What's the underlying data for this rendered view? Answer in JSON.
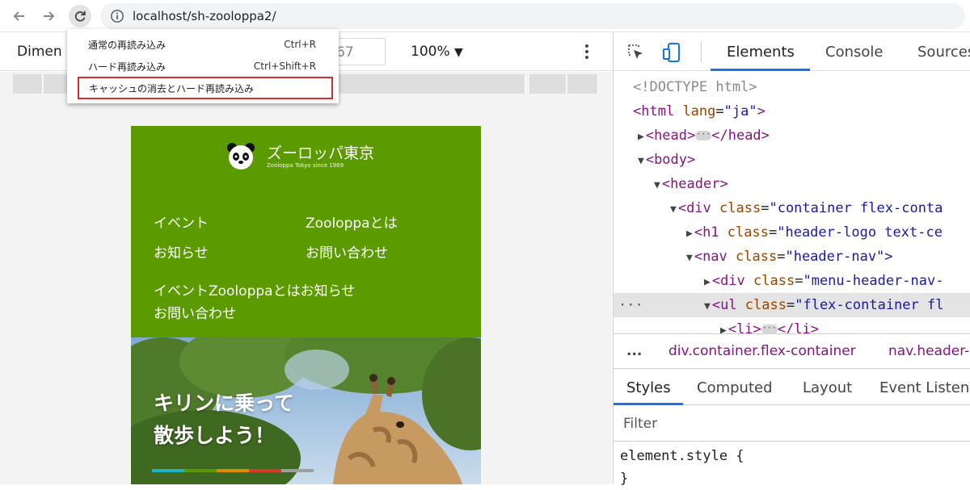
{
  "browser": {
    "url": "localhost/sh-zooloppa2/"
  },
  "context_menu": {
    "items": [
      {
        "label": "通常の再読み込み",
        "shortcut": "Ctrl+R"
      },
      {
        "label": "ハード再読み込み",
        "shortcut": "Ctrl+Shift+R"
      },
      {
        "label": "キャッシュの消去とハード再読み込み",
        "shortcut": ""
      }
    ]
  },
  "device_toolbar": {
    "dimensions_label": "Dimen",
    "height_value": "67",
    "zoom": "100%",
    "zoom_arrow": "▼"
  },
  "site": {
    "brand_name": "ズーロッパ東京",
    "tagline": "Zooloppa Tokyo since 1969",
    "nav_grid": [
      "イベント",
      "Zooloppaとは",
      "お知らせ",
      "お問い合わせ"
    ],
    "nav_inline_1": "イベントZooloppaとはお知らせ",
    "nav_inline_2": "お問い合わせ",
    "hero_line_1": "キリンに乗って",
    "hero_line_2": "散歩しよう！",
    "header_color": "#5b9b00",
    "stripe_colors": [
      "#1fb3c9",
      "#5a9a00",
      "#e08a00",
      "#d93b2b",
      "#9e9e9e"
    ]
  },
  "devtools": {
    "tabs": [
      "Elements",
      "Console",
      "Sources"
    ],
    "active_tab": "Elements",
    "code_lines": {
      "doctype": "<!DOCTYPE html>",
      "html_open": "<html",
      "html_attr": "lang",
      "html_val": "\"ja\"",
      "head_open": "<head>",
      "head_close": "</head>",
      "body_open": "<body>",
      "header_open": "<header>",
      "div_open": "<div",
      "div_attr": "class",
      "div_val": "\"container flex-conta",
      "h1_open": "<h1",
      "h1_attr": "class",
      "h1_val": "\"header-logo text-ce",
      "nav_open": "<nav",
      "nav_attr": "class",
      "nav_val": "\"header-nav\">",
      "div2_open": "<div",
      "div2_attr": "class",
      "div2_val": "\"menu-header-nav-",
      "ul_open": "<ul",
      "ul_attr": "class",
      "ul_val": "\"flex-container fl",
      "li_open": "<li>",
      "li_close": "</li>",
      "gutter_dots": "···"
    },
    "breadcrumbs": {
      "more": "...",
      "items": [
        "div.container.flex-container",
        "nav.header-"
      ]
    },
    "styles_tabs": [
      "Styles",
      "Computed",
      "Layout",
      "Event Listene"
    ],
    "filter_placeholder": "Filter",
    "rules": [
      "element.style {",
      "}"
    ]
  }
}
